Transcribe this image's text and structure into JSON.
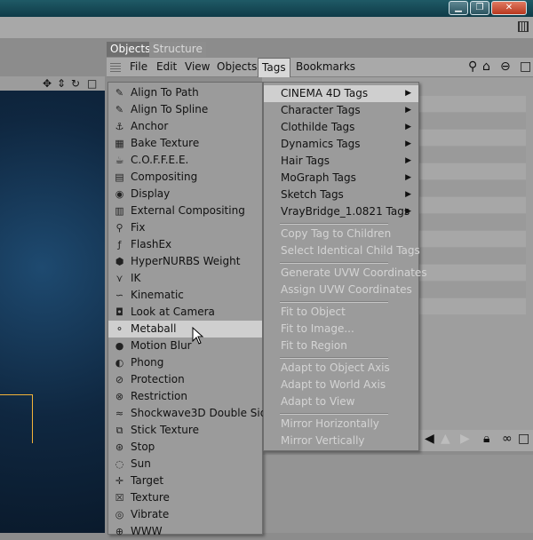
{
  "window": {
    "minimize_icon": "minimize-icon",
    "restore_icon": "restore-icon",
    "close_icon": "close-icon"
  },
  "panel": {
    "tabs": [
      "Objects",
      "Structure"
    ],
    "menu": [
      "File",
      "Edit",
      "View",
      "Objects",
      "Tags",
      "Bookmarks"
    ],
    "active_menu": "Tags"
  },
  "tags_menu": [
    {
      "label": "Align To Path",
      "icon": "align-path-icon"
    },
    {
      "label": "Align To Spline",
      "icon": "align-spline-icon"
    },
    {
      "label": "Anchor",
      "icon": "anchor-icon"
    },
    {
      "label": "Bake Texture",
      "icon": "bake-texture-icon"
    },
    {
      "label": "C.O.F.F.E.E.",
      "icon": "coffee-icon"
    },
    {
      "label": "Compositing",
      "icon": "compositing-icon"
    },
    {
      "label": "Display",
      "icon": "display-icon"
    },
    {
      "label": "External Compositing",
      "icon": "external-compositing-icon"
    },
    {
      "label": "Fix",
      "icon": "fix-icon"
    },
    {
      "label": "FlashEx",
      "icon": "flashex-icon"
    },
    {
      "label": "HyperNURBS Weight",
      "icon": "hypernurbs-weight-icon"
    },
    {
      "label": "IK",
      "icon": "ik-icon"
    },
    {
      "label": "Kinematic",
      "icon": "kinematic-icon"
    },
    {
      "label": "Look at Camera",
      "icon": "look-at-camera-icon"
    },
    {
      "label": "Metaball",
      "icon": "metaball-icon"
    },
    {
      "label": "Motion Blur",
      "icon": "motion-blur-icon"
    },
    {
      "label": "Phong",
      "icon": "phong-icon"
    },
    {
      "label": "Protection",
      "icon": "protection-icon"
    },
    {
      "label": "Restriction",
      "icon": "restriction-icon"
    },
    {
      "label": "Shockwave3D Double Sided",
      "icon": "shockwave-icon"
    },
    {
      "label": "Stick Texture",
      "icon": "stick-texture-icon"
    },
    {
      "label": "Stop",
      "icon": "stop-icon"
    },
    {
      "label": "Sun",
      "icon": "sun-icon"
    },
    {
      "label": "Target",
      "icon": "target-icon"
    },
    {
      "label": "Texture",
      "icon": "texture-icon"
    },
    {
      "label": "Vibrate",
      "icon": "vibrate-icon"
    },
    {
      "label": "WWW",
      "icon": "www-icon"
    }
  ],
  "highlighted_item": "Metaball",
  "submenu": {
    "categories": [
      "CINEMA 4D Tags",
      "Character Tags",
      "Clothilde Tags",
      "Dynamics Tags",
      "Hair Tags",
      "MoGraph Tags",
      "Sketch Tags",
      "VrayBridge_1.0821 Tags"
    ],
    "group2": [
      "Copy Tag to Children",
      "Select Identical Child Tags"
    ],
    "group3": [
      "Generate UVW Coordinates",
      "Assign UVW Coordinates"
    ],
    "group4": [
      "Fit to Object",
      "Fit to Image...",
      "Fit to Region"
    ],
    "group5": [
      "Adapt to Object Axis",
      "Adapt to World Axis",
      "Adapt to View"
    ],
    "group6": [
      "Mirror Horizontally",
      "Mirror Vertically"
    ]
  },
  "colors": {
    "title_bar": "#0f3b48",
    "menu_bg": "#9b9b9b",
    "highlight": "#cfcfcf",
    "disabled_text": "#d4d4d4",
    "viewport": "#0f2740",
    "object_outline": "#f3b33a"
  }
}
